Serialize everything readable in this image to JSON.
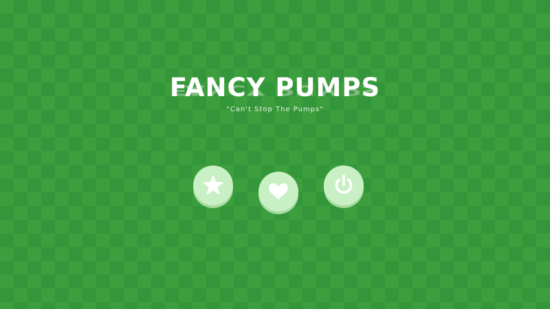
{
  "game": {
    "title": "FANCY PUMPS",
    "subtitle": "\"Can't Stop The Pumps\""
  },
  "colors": {
    "background": "#3d9e3d",
    "pattern": "#34963a",
    "button_face": "#c9f0c4",
    "icon": "#ffffff"
  },
  "buttons": [
    {
      "icon": "star-icon"
    },
    {
      "icon": "heart-icon"
    },
    {
      "icon": "power-icon"
    }
  ]
}
